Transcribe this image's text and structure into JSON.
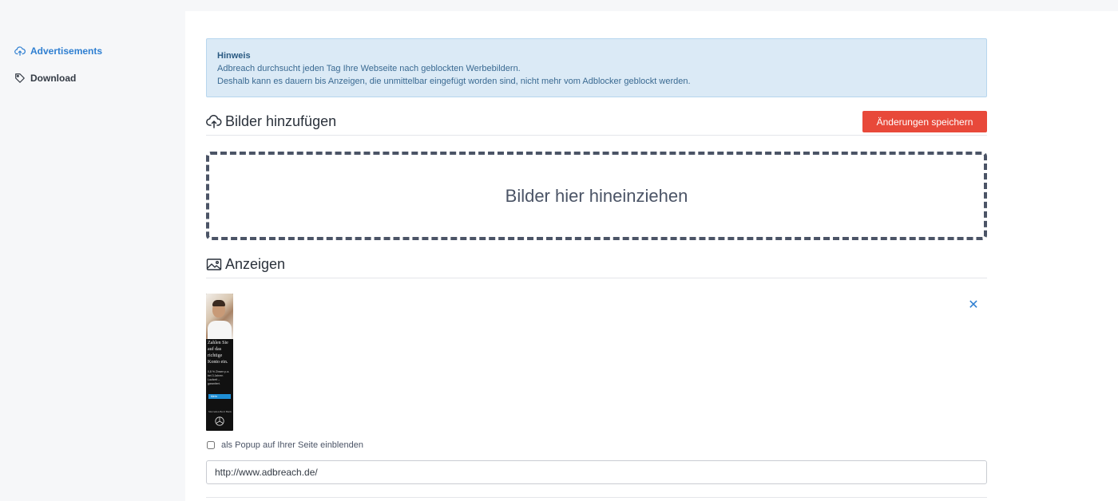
{
  "sidebar": {
    "items": [
      {
        "label": "Advertisements",
        "icon": "cloud-upload-icon",
        "active": true
      },
      {
        "label": "Download",
        "icon": "tag-icon",
        "active": false
      }
    ]
  },
  "notice": {
    "title": "Hinweis",
    "line1": "Adbreach durchsucht jeden Tag Ihre Webseite nach geblockten Werbebildern.",
    "line2": "Deshalb kann es dauern bis Anzeigen, die unmittelbar eingefügt worden sind, nicht mehr vom Adblocker geblockt werden."
  },
  "upload": {
    "title": "Bilder hinzufügen",
    "save_label": "Änderungen speichern",
    "dropzone_label": "Bilder hier hineinziehen"
  },
  "ads": {
    "title": "Anzeigen",
    "items": [
      {
        "thumb_text": "Zahlen Sie auf das richtige Konto ein.",
        "thumb_small": "0,8 % Zinsen p.a. bei 3 Jahren Laufzeit – garantiert.",
        "thumb_button": "Mehr",
        "thumb_brand": "Mercedes-Benz Bank",
        "remove_label": "✕",
        "popup_label": "als Popup auf Ihrer Seite einblenden",
        "popup_checked": false,
        "url_value": "http://www.adbreach.de/"
      }
    ]
  },
  "colors": {
    "accent": "#2f7fd1",
    "danger": "#e8493a",
    "notice_bg": "#dbeaf6"
  }
}
